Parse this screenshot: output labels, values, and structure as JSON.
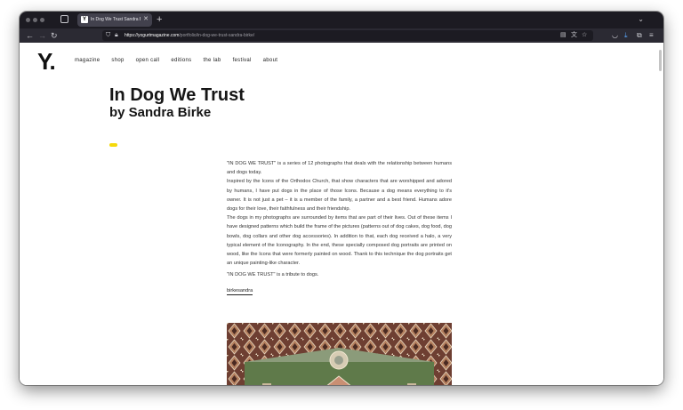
{
  "browser": {
    "tab_title": "In Dog We Trust Sandra Birke | Y",
    "favicon_letter": "Y",
    "url_domain": "https://yogurtmagazine.com",
    "url_path": "/portfolio/in-dog-we-trust-sandra-birke/",
    "icons": {
      "tabs": "tab-overview-icon",
      "close": "close-icon",
      "new_tab": "plus-icon",
      "list_all": "chevron-down-icon",
      "back": "back-arrow-icon",
      "forward": "forward-arrow-icon",
      "reload": "reload-icon",
      "shield": "shield-icon",
      "lock": "lock-icon",
      "reader": "reader-view-icon",
      "translate": "translate-icon",
      "bookmark": "star-icon",
      "pocket": "pocket-icon",
      "downloads": "download-icon",
      "extensions": "extensions-icon",
      "menu": "hamburger-menu-icon"
    }
  },
  "site": {
    "logo": "Y.",
    "nav": [
      "magazine",
      "shop",
      "open call",
      "editions",
      "the lab",
      "festival",
      "about"
    ]
  },
  "article": {
    "title": "In Dog We Trust",
    "subtitle": "by Sandra Birke",
    "accent_color": "#f5d90a",
    "paragraphs": [
      "\"IN DOG WE TRUST\" is a series of 12 photographs that deals with the relationship between humans and dogs today.",
      "Inspired by the Icons of the Orthodox Church, that show characters that are worshipped and adored by humans, I have put dogs in the place of those Icons. Because a dog means everything to it's owner. It is not just a pet – it is a member of the family, a partner and a best friend. Humans adore dogs for their love, their faithfulness and their friendship.",
      "The dogs in my photographs are surrounded by items that are part of their lives. Out of these items I have designed patterns which build the frame of the pictures (patterns out of dog cakes, dog food, dog bowls, dog collars and other dog accessories). In addition to that, each dog received a halo, a very typical element of the Iconography. In the end, these specially composed dog portraits are printed on wood, like the Icons that were formerly painted on wood. Thank to this technique the dog portraits get an unique painting-like character."
    ],
    "closing": "\"IN DOG WE TRUST\" is a tribute to dogs.",
    "handle": "birkesandra"
  }
}
